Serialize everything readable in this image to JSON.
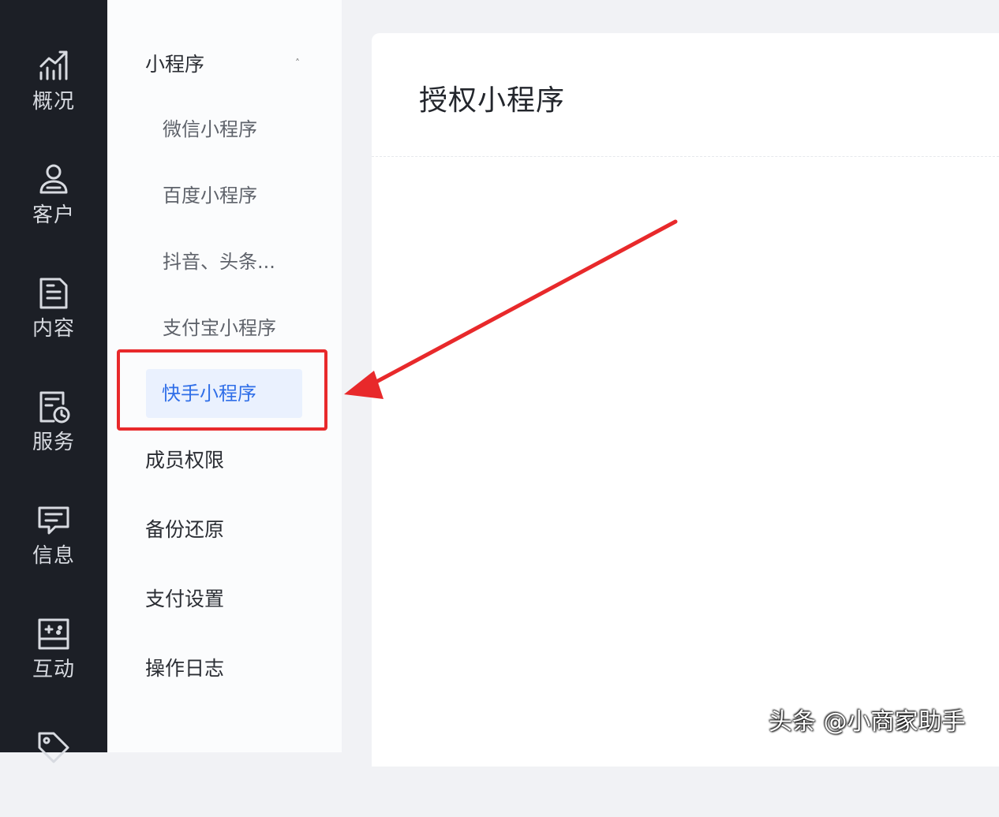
{
  "rail": {
    "items": [
      {
        "label": "概况",
        "icon": "chart-icon"
      },
      {
        "label": "客户",
        "icon": "user-icon"
      },
      {
        "label": "内容",
        "icon": "document-icon"
      },
      {
        "label": "服务",
        "icon": "service-icon"
      },
      {
        "label": "信息",
        "icon": "message-icon"
      },
      {
        "label": "互动",
        "icon": "interaction-icon"
      },
      {
        "label": "",
        "icon": "tag-icon"
      }
    ]
  },
  "submenu": {
    "group": {
      "label": "小程序",
      "caret": "˄"
    },
    "sub_items": [
      "微信小程序",
      "百度小程序",
      "抖音、头条...",
      "支付宝小程序"
    ],
    "active": "快手小程序",
    "top_items": [
      "成员权限",
      "备份还原",
      "支付设置",
      "操作日志"
    ]
  },
  "main": {
    "title": "授权小程序"
  },
  "annotation": {
    "color": "#e8292b"
  },
  "watermark": "头条 @小商家助手"
}
